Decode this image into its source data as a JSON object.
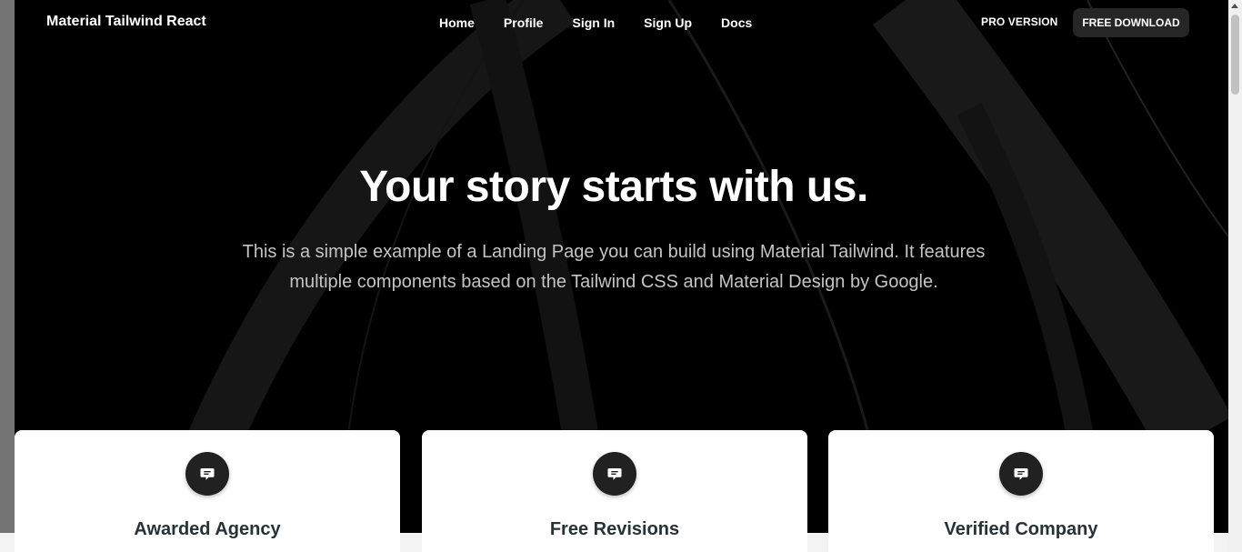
{
  "nav": {
    "brand": "Material Tailwind React",
    "links": [
      "Home",
      "Profile",
      "Sign In",
      "Sign Up",
      "Docs"
    ],
    "pro_label": "PRO VERSION",
    "download_label": "FREE DOWNLOAD"
  },
  "hero": {
    "title": "Your story starts with us.",
    "subtitle": "This is a simple example of a Landing Page you can build using Material Tailwind. It features multiple components based on the Tailwind CSS and Material Design by Google."
  },
  "features": [
    {
      "title": "Awarded Agency",
      "icon": "chat-bubble-icon"
    },
    {
      "title": "Free Revisions",
      "icon": "chat-bubble-icon"
    },
    {
      "title": "Verified Company",
      "icon": "chat-bubble-icon"
    }
  ],
  "colors": {
    "hero_bg": "#000000",
    "card_bg": "#ffffff",
    "icon_bg": "#212121",
    "title_text": "#263238",
    "button_bg": "#262626"
  }
}
